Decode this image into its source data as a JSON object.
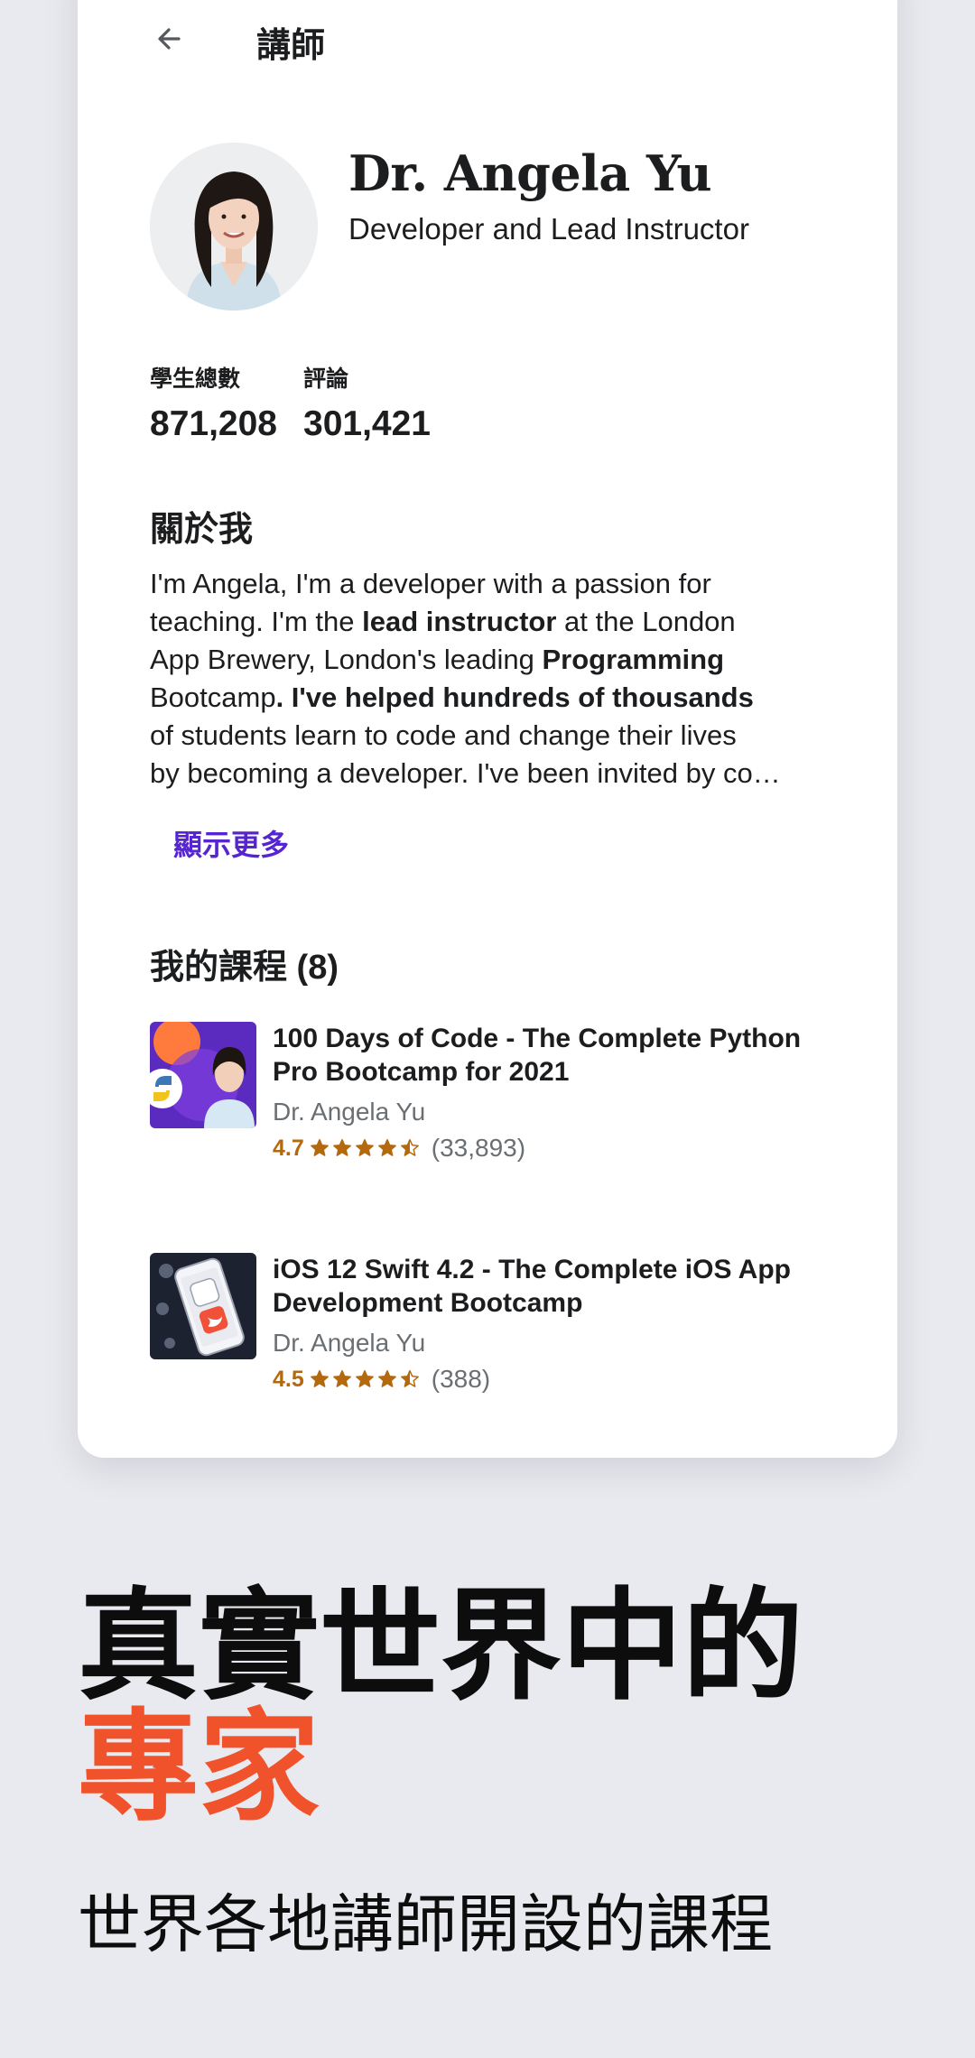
{
  "header": {
    "title": "講師"
  },
  "instructor": {
    "name": "Dr. Angela Yu",
    "role": "Developer and Lead Instructor"
  },
  "stats": {
    "students_label": "學生總數",
    "students_value": "871,208",
    "reviews_label": "評論",
    "reviews_value": "301,421"
  },
  "about": {
    "title": "關於我",
    "lines": [
      [
        "I'm Angela, I'm a developer with a passion for"
      ],
      [
        "teaching. I'm the ",
        "lead instructor",
        " at the London"
      ],
      [
        "App Brewery, London's leading ",
        "Programming"
      ],
      [
        "Bootcamp",
        ". I've helped hundreds of thousands"
      ],
      [
        "of students learn to code and change their lives"
      ],
      [
        "by becoming a developer. I've been invited by co…"
      ]
    ],
    "show_more": "顯示更多"
  },
  "courses": {
    "title": "我的課程 (8)",
    "items": [
      {
        "title": "100 Days of Code - The Complete Python Pro Bootcamp for 2021",
        "author": "Dr. Angela Yu",
        "rating": "4.7",
        "rating_stars": 4.7,
        "reviews": "(33,893)"
      },
      {
        "title": "iOS 12 Swift 4.2 - The Complete iOS App Development Bootcamp",
        "author": "Dr. Angela Yu",
        "rating": "4.5",
        "rating_stars": 4.5,
        "reviews": "(388)"
      }
    ]
  },
  "promo": {
    "headline": "真實世界中的",
    "headline_accent": "專家",
    "subheadline": "世界各地講師開設的課程"
  },
  "colors": {
    "background": "#e9eaef",
    "accent_orange": "#f0522c",
    "link_purple": "#5624d0",
    "rating_orange": "#b4690e"
  }
}
